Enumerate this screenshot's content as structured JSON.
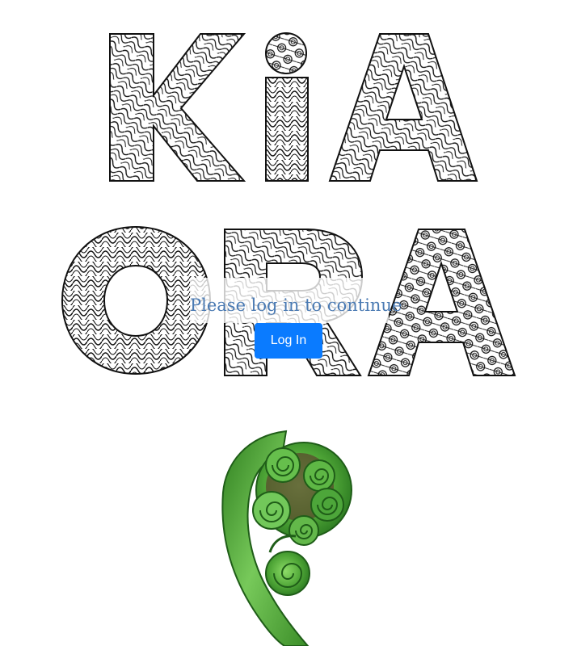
{
  "background": {
    "artwork": "kia-ora-lettering-with-koru-fern",
    "lettering_lines": [
      "KIA",
      "ORA"
    ],
    "colors": {
      "ink": "#111111",
      "fern_dark": "#2f7f1f",
      "fern_light": "#67c14b",
      "fern_core": "#6a4a2a"
    }
  },
  "login": {
    "prompt": "Please log in to continue",
    "button_label": "Log In",
    "prompt_color": "#4a7ab3",
    "button_color": "#0a7bff",
    "button_text_color": "#ffffff"
  }
}
